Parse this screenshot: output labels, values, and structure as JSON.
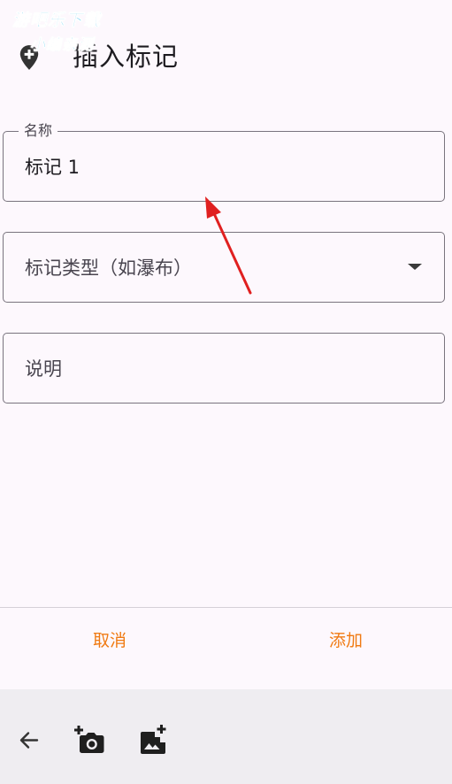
{
  "watermark": {
    "line1": "游吧乐下载",
    "line2": "小编亲测"
  },
  "header": {
    "icon": "add-location-icon",
    "title": "插入标记"
  },
  "form": {
    "name_field": {
      "label": "名称",
      "value": "标记 1"
    },
    "type_field": {
      "placeholder": "标记类型（如瀑布）",
      "icon": "dropdown-arrow-icon"
    },
    "description_field": {
      "placeholder": "说明"
    }
  },
  "actions": {
    "cancel_label": "取消",
    "add_label": "添加",
    "accent_color": "#f07a12"
  },
  "toolbar": {
    "icons": [
      "back-arrow-icon",
      "add-camera-icon",
      "add-photo-icon"
    ]
  },
  "annotation": {
    "arrow_color": "#e02020"
  }
}
